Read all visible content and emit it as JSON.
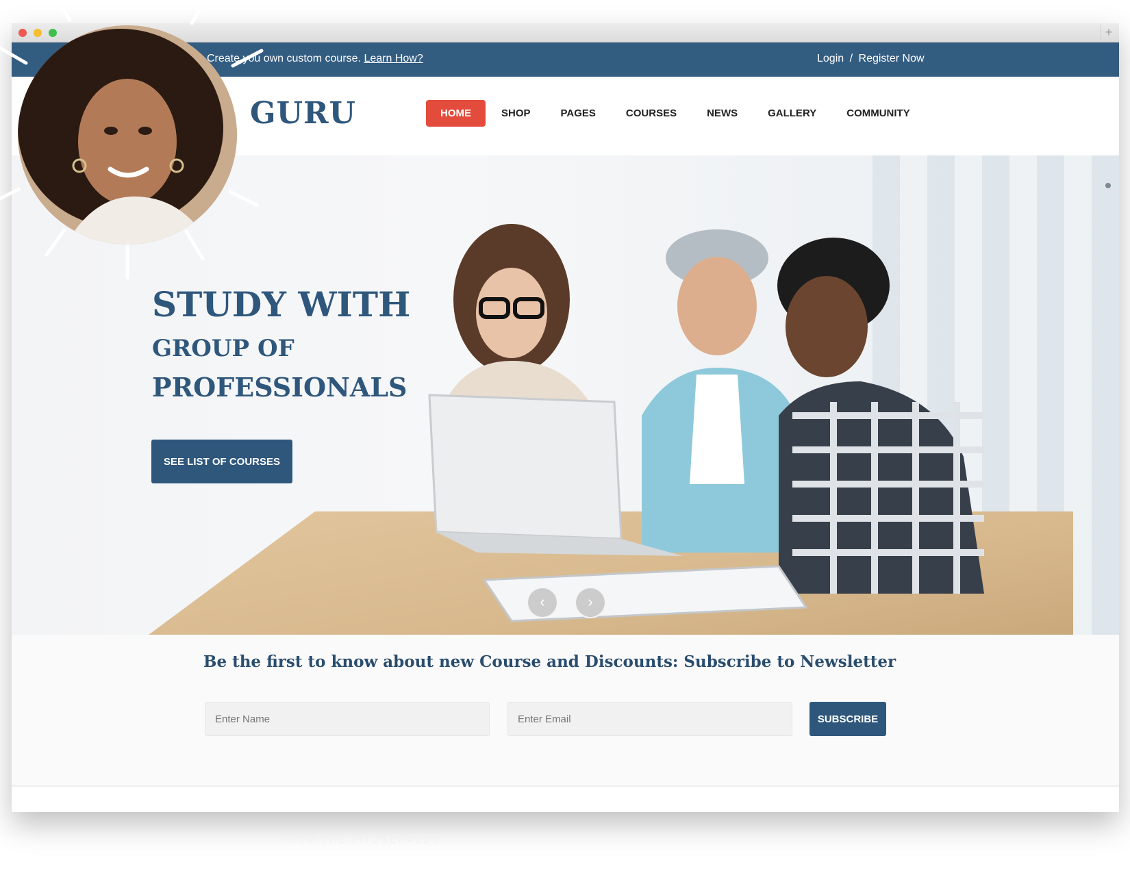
{
  "topbar": {
    "promo_text": "Create you own custom course.",
    "promo_link": "Learn How?",
    "login": "Login",
    "separator": "/",
    "register": "Register Now"
  },
  "header": {
    "logo": "GURU",
    "nav": [
      {
        "label": "HOME",
        "active": true
      },
      {
        "label": "SHOP"
      },
      {
        "label": "PAGES"
      },
      {
        "label": "COURSES"
      },
      {
        "label": "NEWS"
      },
      {
        "label": "GALLERY"
      },
      {
        "label": "COMMUNITY"
      }
    ]
  },
  "hero": {
    "line1": "STUDY WITH",
    "line2": "GROUP OF",
    "line3": "PROFESSIONALS",
    "cta": "SEE LIST OF COURSES"
  },
  "newsletter": {
    "title": "Be the first to know about new Course and Discounts: Subscribe to Newsletter",
    "name_placeholder": "Enter Name",
    "email_placeholder": "Enter Email",
    "subscribe": "SUBSCRIBE"
  },
  "credit": "FROM THE FITZGERALDS",
  "colors": {
    "brand_blue": "#2f577c",
    "topbar_blue": "#335c81",
    "accent_red": "#e34c3c"
  }
}
